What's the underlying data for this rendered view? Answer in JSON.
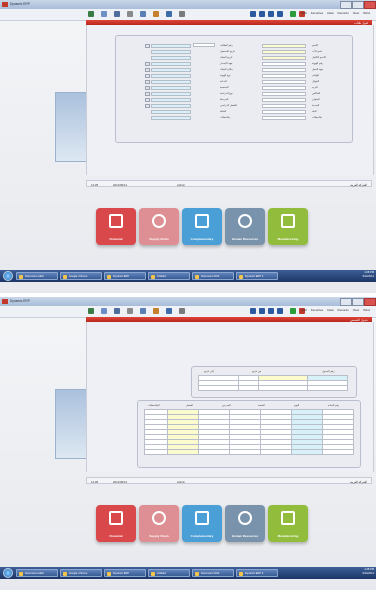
{
  "app": {
    "title": "Dynamic ERP",
    "menu": [
      "Edit",
      "Favorites",
      "Data",
      "Records",
      "View",
      "Wind"
    ],
    "toolbar_icons": [
      "run-icon",
      "filter-icon",
      "save-icon",
      "print-icon",
      "search-icon",
      "calendar-icon",
      "sum-icon",
      "attach-icon",
      "first-icon",
      "prev-icon",
      "next-icon",
      "last-icon",
      "add-icon",
      "delete-icon"
    ]
  },
  "screens": [
    {
      "form_title": "قبول طالب",
      "left_group": [
        {
          "label": "رقم الطالب"
        },
        {
          "label": "تاريخ التسجيل"
        },
        {
          "label": "تاريخ الميلاد"
        },
        {
          "label": "جهة الإصدار"
        },
        {
          "label": "مكان الميلاد"
        },
        {
          "label": "نوع الهوية"
        },
        {
          "label": "الديانة"
        },
        {
          "label": "الجنسية"
        },
        {
          "label": "نوع الدراسة"
        },
        {
          "label": "المرحلة"
        },
        {
          "label": "الفصل الدراسي"
        },
        {
          "label": "الحالة"
        },
        {
          "label": "ملاحظات"
        }
      ],
      "right_group": [
        {
          "label": "الاسم"
        },
        {
          "label": "اسم الأب"
        },
        {
          "label": "الاسم الكامل"
        },
        {
          "label": "رقم الهوية"
        },
        {
          "label": "جهة العمل"
        },
        {
          "label": "الهاتف"
        },
        {
          "label": "الجوال"
        },
        {
          "label": "البريد"
        },
        {
          "label": "الفاكس"
        },
        {
          "label": "العنوان"
        },
        {
          "label": "المدينة"
        },
        {
          "label": "البلد"
        },
        {
          "label": "ملاحظات"
        }
      ]
    },
    {
      "form_title": "جدول الحصص",
      "top_table_headers": [
        "رقم الجدول",
        "من تاريخ",
        "إلى تاريخ"
      ],
      "grid_headers": [
        "رقم المادة",
        "اليوم",
        "الحصة",
        "المدرس",
        "الفصل",
        "الملاحظات"
      ]
    }
  ],
  "status": {
    "company": "الشركة العربية",
    "user": "Admin",
    "date": "2014/09/14",
    "time": "14:28"
  },
  "modules": [
    {
      "name": "Financial",
      "icon": "financial-chart-icon",
      "color": "#d9484a"
    },
    {
      "name": "Supply Chain",
      "icon": "supply-chain-icon",
      "color": "#de8f93"
    },
    {
      "name": "Complementary",
      "icon": "grid-blocks-icon",
      "color": "#4a9fd6"
    },
    {
      "name": "Human Resources",
      "icon": "person-icon",
      "color": "#7a93ad"
    },
    {
      "name": "Manufacturing",
      "icon": "factory-icon",
      "color": "#92bd3c"
    }
  ],
  "taskbar": {
    "items": [
      "Document editor",
      "Google Chrome",
      "Dynamic ERP",
      "Untitled",
      "Document 2014",
      "Dynamic ERP 2"
    ],
    "clock": "4:28 PM",
    "date": "9/14/2014"
  }
}
